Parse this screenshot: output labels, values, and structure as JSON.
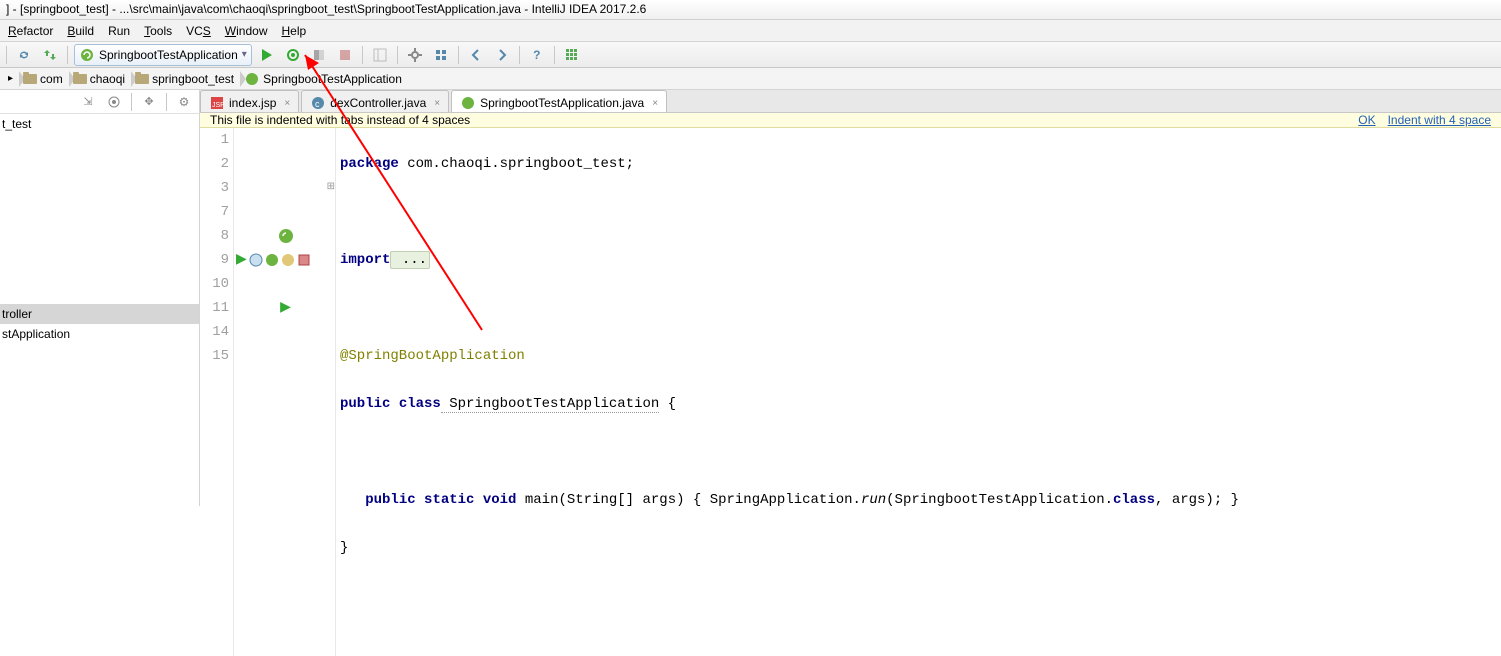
{
  "title": "] - [springboot_test] - ...\\src\\main\\java\\com\\chaoqi\\springboot_test\\SpringbootTestApplication.java - IntelliJ IDEA 2017.2.6",
  "menu": {
    "refactor": "efactor",
    "build": "uild",
    "run": "un",
    "tools": "ools",
    "vcs": "VC",
    "window": "indow",
    "help": "elp"
  },
  "runConfig": {
    "label": "SpringbootTestApplication"
  },
  "breadcrumb": {
    "items": [
      "",
      "com",
      "chaoqi",
      "springboot_test",
      "SpringbootTestApplication"
    ]
  },
  "sidebar": {
    "project": "t_test",
    "items": [
      "troller",
      "stApplication"
    ]
  },
  "tabs": [
    {
      "label": "index.jsp",
      "active": false
    },
    {
      "label": "dexController.java",
      "active": false
    },
    {
      "label": "SpringbootTestApplication.java",
      "active": true
    }
  ],
  "notice": {
    "text": "This file is indented with tabs instead of 4 spaces",
    "ok": "OK",
    "action": "Indent with 4 space"
  },
  "code": {
    "lines": [
      "1",
      "2",
      "3",
      "7",
      "8",
      "9",
      "10",
      "11",
      "14",
      "15"
    ],
    "l1_pkg": "package",
    "l1_rest": " com.chaoqi.springboot_test;",
    "l3_imp": "import",
    "l3_rest": " ...",
    "l8": "@SpringBootApplication",
    "l9_pub": "public",
    "l9_cls": " class",
    "l9_name": " SpringbootTestApplication",
    "l9_brace": " {",
    "l11_pub": "public",
    "l11_static": " static",
    "l11_void": " void",
    "l11_main": " main(String[] args) { SpringApplication.",
    "l11_run": "run",
    "l11_rest": "(SpringbootTestApplication.",
    "l11_classkw": "class",
    "l11_end": ", args); }",
    "l14": "}"
  }
}
